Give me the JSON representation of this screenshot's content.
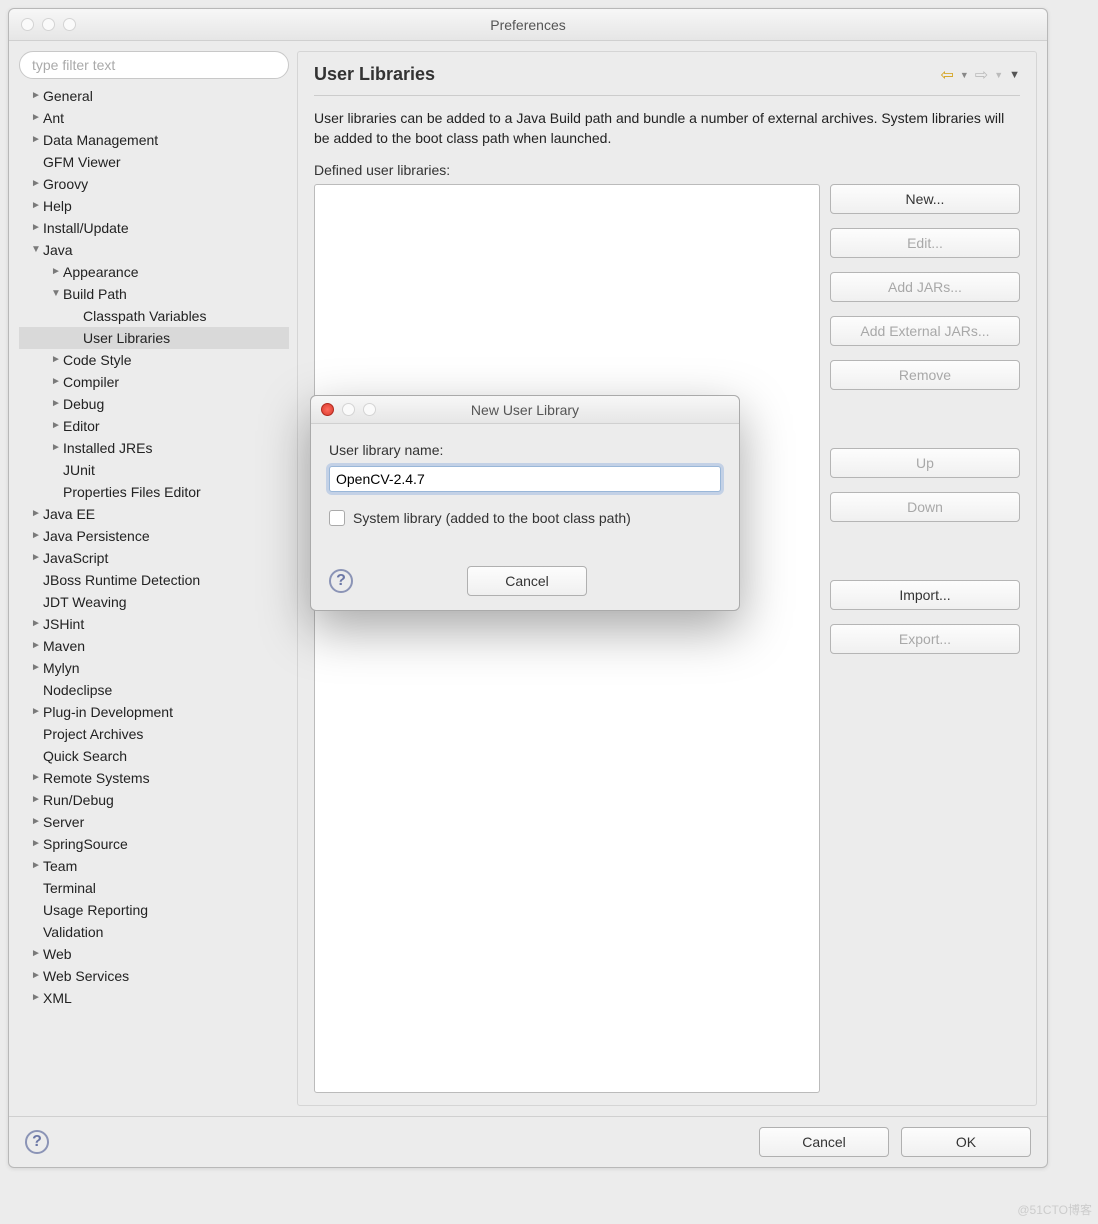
{
  "window": {
    "title": "Preferences"
  },
  "sidebar": {
    "filter_placeholder": "type filter text",
    "items": [
      {
        "label": "General",
        "indent": 0,
        "twisty": "►",
        "sel": false
      },
      {
        "label": "Ant",
        "indent": 0,
        "twisty": "►",
        "sel": false
      },
      {
        "label": "Data Management",
        "indent": 0,
        "twisty": "►",
        "sel": false
      },
      {
        "label": "GFM Viewer",
        "indent": 0,
        "twisty": "",
        "sel": false
      },
      {
        "label": "Groovy",
        "indent": 0,
        "twisty": "►",
        "sel": false
      },
      {
        "label": "Help",
        "indent": 0,
        "twisty": "►",
        "sel": false
      },
      {
        "label": "Install/Update",
        "indent": 0,
        "twisty": "►",
        "sel": false
      },
      {
        "label": "Java",
        "indent": 0,
        "twisty": "▼",
        "sel": false
      },
      {
        "label": "Appearance",
        "indent": 1,
        "twisty": "►",
        "sel": false
      },
      {
        "label": "Build Path",
        "indent": 1,
        "twisty": "▼",
        "sel": false
      },
      {
        "label": "Classpath Variables",
        "indent": 2,
        "twisty": "",
        "sel": false
      },
      {
        "label": "User Libraries",
        "indent": 2,
        "twisty": "",
        "sel": true
      },
      {
        "label": "Code Style",
        "indent": 1,
        "twisty": "►",
        "sel": false
      },
      {
        "label": "Compiler",
        "indent": 1,
        "twisty": "►",
        "sel": false
      },
      {
        "label": "Debug",
        "indent": 1,
        "twisty": "►",
        "sel": false
      },
      {
        "label": "Editor",
        "indent": 1,
        "twisty": "►",
        "sel": false
      },
      {
        "label": "Installed JREs",
        "indent": 1,
        "twisty": "►",
        "sel": false
      },
      {
        "label": "JUnit",
        "indent": 1,
        "twisty": "",
        "sel": false
      },
      {
        "label": "Properties Files Editor",
        "indent": 1,
        "twisty": "",
        "sel": false
      },
      {
        "label": "Java EE",
        "indent": 0,
        "twisty": "►",
        "sel": false
      },
      {
        "label": "Java Persistence",
        "indent": 0,
        "twisty": "►",
        "sel": false
      },
      {
        "label": "JavaScript",
        "indent": 0,
        "twisty": "►",
        "sel": false
      },
      {
        "label": "JBoss Runtime Detection",
        "indent": 0,
        "twisty": "",
        "sel": false
      },
      {
        "label": "JDT Weaving",
        "indent": 0,
        "twisty": "",
        "sel": false
      },
      {
        "label": "JSHint",
        "indent": 0,
        "twisty": "►",
        "sel": false
      },
      {
        "label": "Maven",
        "indent": 0,
        "twisty": "►",
        "sel": false
      },
      {
        "label": "Mylyn",
        "indent": 0,
        "twisty": "►",
        "sel": false
      },
      {
        "label": "Nodeclipse",
        "indent": 0,
        "twisty": "",
        "sel": false
      },
      {
        "label": "Plug-in Development",
        "indent": 0,
        "twisty": "►",
        "sel": false
      },
      {
        "label": "Project Archives",
        "indent": 0,
        "twisty": "",
        "sel": false
      },
      {
        "label": "Quick Search",
        "indent": 0,
        "twisty": "",
        "sel": false
      },
      {
        "label": "Remote Systems",
        "indent": 0,
        "twisty": "►",
        "sel": false
      },
      {
        "label": "Run/Debug",
        "indent": 0,
        "twisty": "►",
        "sel": false
      },
      {
        "label": "Server",
        "indent": 0,
        "twisty": "►",
        "sel": false
      },
      {
        "label": "SpringSource",
        "indent": 0,
        "twisty": "►",
        "sel": false
      },
      {
        "label": "Team",
        "indent": 0,
        "twisty": "►",
        "sel": false
      },
      {
        "label": "Terminal",
        "indent": 0,
        "twisty": "",
        "sel": false
      },
      {
        "label": "Usage Reporting",
        "indent": 0,
        "twisty": "",
        "sel": false
      },
      {
        "label": "Validation",
        "indent": 0,
        "twisty": "",
        "sel": false
      },
      {
        "label": "Web",
        "indent": 0,
        "twisty": "►",
        "sel": false
      },
      {
        "label": "Web Services",
        "indent": 0,
        "twisty": "►",
        "sel": false
      },
      {
        "label": "XML",
        "indent": 0,
        "twisty": "►",
        "sel": false
      }
    ]
  },
  "main": {
    "heading": "User Libraries",
    "description": "User libraries can be added to a Java Build path and bundle a number of external archives. System libraries will be added to the boot class path when launched.",
    "list_label": "Defined user libraries:",
    "buttons": {
      "new": "New...",
      "edit": "Edit...",
      "add_jars": "Add JARs...",
      "add_ext_jars": "Add External JARs...",
      "remove": "Remove",
      "up": "Up",
      "down": "Down",
      "import": "Import...",
      "export": "Export..."
    }
  },
  "footer": {
    "cancel": "Cancel",
    "ok": "OK"
  },
  "dialog": {
    "title": "New User Library",
    "field_label": "User library name:",
    "value": "OpenCV-2.4.7",
    "checkbox_label": "System library (added to the boot class path)",
    "cancel": "Cancel"
  },
  "watermark": "@51CTO博客"
}
